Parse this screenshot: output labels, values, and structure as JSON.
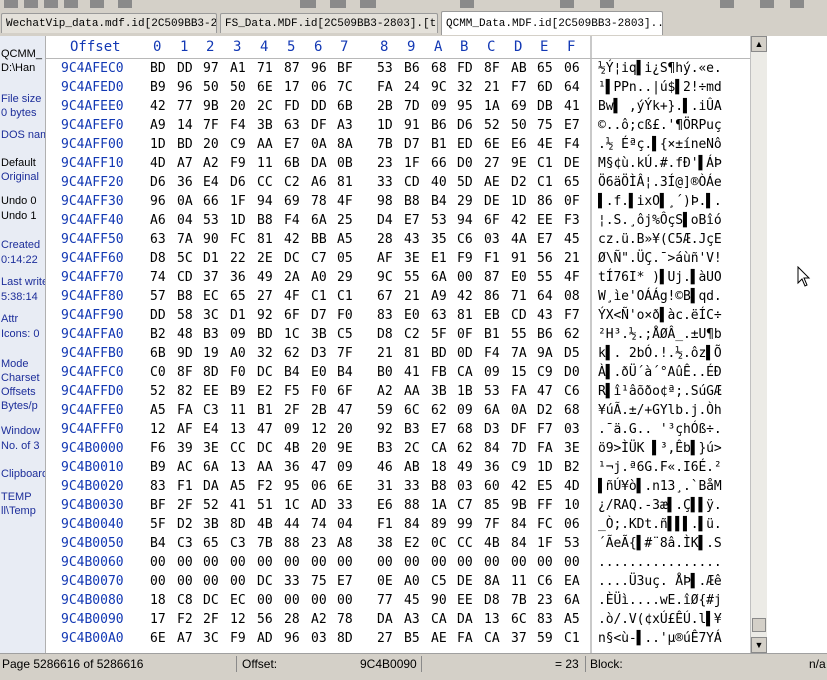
{
  "tabs": [
    {
      "label": "WechatVip_data.mdf.id[2C509BB3-2..."
    },
    {
      "label": "FS_Data.MDF.id[2C509BB3-2803].[t..."
    },
    {
      "label": "QCMM_Data.MDF.id[2C509BB3-2803]...."
    }
  ],
  "sidebar": {
    "items": [
      {
        "text": "QCMM_"
      },
      {
        "text": "D:\\Han"
      },
      {
        "text": "File size"
      },
      {
        "text": "0 bytes"
      },
      {
        "text": "DOS name"
      },
      {
        "text": "Default"
      },
      {
        "text": "Original"
      },
      {
        "text": "Undo 0"
      },
      {
        "text": "Undo 1"
      },
      {
        "text": "Created"
      },
      {
        "text": "0:14:22"
      },
      {
        "text": "Last write"
      },
      {
        "text": "5:38:14"
      },
      {
        "text": "Attr"
      },
      {
        "text": "Icons: 0"
      },
      {
        "text": "Mode"
      },
      {
        "text": "Charset"
      },
      {
        "text": "Offsets"
      },
      {
        "text": "Bytes/p"
      },
      {
        "text": "Window"
      },
      {
        "text": "No. of 3"
      },
      {
        "text": "Clipboard"
      },
      {
        "text": "TEMP"
      },
      {
        "text": "ll\\Temp"
      }
    ]
  },
  "header": {
    "offset_label": "Offset",
    "columns": [
      "0",
      "1",
      "2",
      "3",
      "4",
      "5",
      "6",
      "7",
      "8",
      "9",
      "A",
      "B",
      "C",
      "D",
      "E",
      "F"
    ]
  },
  "rows": [
    {
      "offset": "9C4AFEC0",
      "bytes": [
        "BD",
        "DD",
        "97",
        "A1",
        "71",
        "87",
        "96",
        "BF",
        "53",
        "B6",
        "68",
        "FD",
        "8F",
        "AB",
        "65",
        "06"
      ],
      "ascii": "½Ý¦iq▌i¿S¶hý.«e."
    },
    {
      "offset": "9C4AFED0",
      "bytes": [
        "B9",
        "96",
        "50",
        "50",
        "6E",
        "17",
        "06",
        "7C",
        "FA",
        "24",
        "9C",
        "32",
        "21",
        "F7",
        "6D",
        "64"
      ],
      "ascii": "¹▌PPn..|ú$▌2!÷md"
    },
    {
      "offset": "9C4AFEE0",
      "bytes": [
        "42",
        "77",
        "9B",
        "20",
        "2C",
        "FD",
        "DD",
        "6B",
        "2B",
        "7D",
        "09",
        "95",
        "1A",
        "69",
        "DB",
        "41"
      ],
      "ascii": "Bw▌ ,ýÝk+}.▌.iÛA"
    },
    {
      "offset": "9C4AFEF0",
      "bytes": [
        "A9",
        "14",
        "7F",
        "F4",
        "3B",
        "63",
        "DF",
        "A3",
        "1D",
        "91",
        "B6",
        "D6",
        "52",
        "50",
        "75",
        "E7"
      ],
      "ascii": "©..ô;cß£.'¶ÖRPuç"
    },
    {
      "offset": "9C4AFF00",
      "bytes": [
        "1D",
        "BD",
        "20",
        "C9",
        "AA",
        "E7",
        "0A",
        "8A",
        "7B",
        "D7",
        "B1",
        "ED",
        "6E",
        "E6",
        "4E",
        "F4"
      ],
      "ascii": ".½ Éªç.▌{×±íneNô"
    },
    {
      "offset": "9C4AFF10",
      "bytes": [
        "4D",
        "A7",
        "A2",
        "F9",
        "11",
        "6B",
        "DA",
        "0B",
        "23",
        "1F",
        "66",
        "D0",
        "27",
        "9E",
        "C1",
        "DE"
      ],
      "ascii": "M§¢ù.kÚ.#.fÐ'▌ÁÞ"
    },
    {
      "offset": "9C4AFF20",
      "bytes": [
        "D6",
        "36",
        "E4",
        "D6",
        "CC",
        "C2",
        "A6",
        "81",
        "33",
        "CD",
        "40",
        "5D",
        "AE",
        "D2",
        "C1",
        "65"
      ],
      "ascii": "Ö6äÖÌÂ¦.3Í@]®ÒÁe"
    },
    {
      "offset": "9C4AFF30",
      "bytes": [
        "96",
        "0A",
        "66",
        "1F",
        "94",
        "69",
        "78",
        "4F",
        "98",
        "B8",
        "B4",
        "29",
        "DE",
        "1D",
        "86",
        "0F"
      ],
      "ascii": "▌.f.▌ixO▌¸´)Þ.▌."
    },
    {
      "offset": "9C4AFF40",
      "bytes": [
        "A6",
        "04",
        "53",
        "1D",
        "B8",
        "F4",
        "6A",
        "25",
        "D4",
        "E7",
        "53",
        "94",
        "6F",
        "42",
        "EE",
        "F3"
      ],
      "ascii": "¦.S.¸ôj%ÔçS▌oBîó"
    },
    {
      "offset": "9C4AFF50",
      "bytes": [
        "63",
        "7A",
        "90",
        "FC",
        "81",
        "42",
        "BB",
        "A5",
        "28",
        "43",
        "35",
        "C6",
        "03",
        "4A",
        "E7",
        "45"
      ],
      "ascii": "cz.ü.B»¥(C5Æ.JçE"
    },
    {
      "offset": "9C4AFF60",
      "bytes": [
        "D8",
        "5C",
        "D1",
        "22",
        "2E",
        "DC",
        "C7",
        "05",
        "AF",
        "3E",
        "E1",
        "F9",
        "F1",
        "91",
        "56",
        "21"
      ],
      "ascii": "Ø\\Ñ\".ÜÇ.¯>áùñ'V!"
    },
    {
      "offset": "9C4AFF70",
      "bytes": [
        "74",
        "CD",
        "37",
        "36",
        "49",
        "2A",
        "A0",
        "29",
        "9C",
        "55",
        "6A",
        "00",
        "87",
        "E0",
        "55",
        "4F"
      ],
      "ascii": "tÍ76I* )▌Uj.▌àUO"
    },
    {
      "offset": "9C4AFF80",
      "bytes": [
        "57",
        "B8",
        "EC",
        "65",
        "27",
        "4F",
        "C1",
        "C1",
        "67",
        "21",
        "A9",
        "42",
        "86",
        "71",
        "64",
        "08"
      ],
      "ascii": "W¸ìe'OÁÁg!©B▌qd."
    },
    {
      "offset": "9C4AFF90",
      "bytes": [
        "DD",
        "58",
        "3C",
        "D1",
        "92",
        "6F",
        "D7",
        "F0",
        "83",
        "E0",
        "63",
        "81",
        "EB",
        "CD",
        "43",
        "F7"
      ],
      "ascii": "ÝX<Ñ'o×ð▌àc.ëÍC÷"
    },
    {
      "offset": "9C4AFFA0",
      "bytes": [
        "B2",
        "48",
        "B3",
        "09",
        "BD",
        "1C",
        "3B",
        "C5",
        "D8",
        "C2",
        "5F",
        "0F",
        "B1",
        "55",
        "B6",
        "62"
      ],
      "ascii": "²H³.½.;ÅØÂ_.±U¶b"
    },
    {
      "offset": "9C4AFFB0",
      "bytes": [
        "6B",
        "9D",
        "19",
        "A0",
        "32",
        "62",
        "D3",
        "7F",
        "21",
        "81",
        "BD",
        "0D",
        "F4",
        "7A",
        "9A",
        "D5"
      ],
      "ascii": "k▌. 2bÓ.!.½.ôz▌Õ"
    },
    {
      "offset": "9C4AFFC0",
      "bytes": [
        "C0",
        "8F",
        "8D",
        "F0",
        "DC",
        "B4",
        "E0",
        "B4",
        "B0",
        "41",
        "FB",
        "CA",
        "09",
        "15",
        "C9",
        "D0"
      ],
      "ascii": "À▌.ðÜ´à´°AûÊ..ÉÐ"
    },
    {
      "offset": "9C4AFFD0",
      "bytes": [
        "52",
        "82",
        "EE",
        "B9",
        "E2",
        "F5",
        "F0",
        "6F",
        "A2",
        "AA",
        "3B",
        "1B",
        "53",
        "FA",
        "47",
        "C6"
      ],
      "ascii": "R▌î¹âõðo¢ª;.SúGÆ"
    },
    {
      "offset": "9C4AFFE0",
      "bytes": [
        "A5",
        "FA",
        "C3",
        "11",
        "B1",
        "2F",
        "2B",
        "47",
        "59",
        "6C",
        "62",
        "09",
        "6A",
        "0A",
        "D2",
        "68"
      ],
      "ascii": "¥úÃ.±/+GYlb.j.Òh"
    },
    {
      "offset": "9C4AFFF0",
      "bytes": [
        "12",
        "AF",
        "E4",
        "13",
        "47",
        "09",
        "12",
        "20",
        "92",
        "B3",
        "E7",
        "68",
        "D3",
        "DF",
        "F7",
        "03"
      ],
      "ascii": ".¯ä.G.. '³çhÓß÷."
    },
    {
      "offset": "9C4B0000",
      "bytes": [
        "F6",
        "39",
        "3E",
        "CC",
        "DC",
        "4B",
        "20",
        "9E",
        "B3",
        "2C",
        "CA",
        "62",
        "84",
        "7D",
        "FA",
        "3E"
      ],
      "ascii": "ö9>ÌÜK ▌³,Êb▌}ú>"
    },
    {
      "offset": "9C4B0010",
      "bytes": [
        "B9",
        "AC",
        "6A",
        "13",
        "AA",
        "36",
        "47",
        "09",
        "46",
        "AB",
        "18",
        "49",
        "36",
        "C9",
        "1D",
        "B2"
      ],
      "ascii": "¹¬j.ª6G.F«.I6É.²"
    },
    {
      "offset": "9C4B0020",
      "bytes": [
        "83",
        "F1",
        "DA",
        "A5",
        "F2",
        "95",
        "06",
        "6E",
        "31",
        "33",
        "B8",
        "03",
        "60",
        "42",
        "E5",
        "4D"
      ],
      "ascii": "▌ñÚ¥ò▌.n13¸.`BåM"
    },
    {
      "offset": "9C4B0030",
      "bytes": [
        "BF",
        "2F",
        "52",
        "41",
        "51",
        "1C",
        "AD",
        "33",
        "E6",
        "88",
        "1A",
        "C7",
        "85",
        "9B",
        "FF",
        "10"
      ],
      "ascii": "¿/RAQ.-3æ▌.Ç▌▌ÿ."
    },
    {
      "offset": "9C4B0040",
      "bytes": [
        "5F",
        "D2",
        "3B",
        "8D",
        "4B",
        "44",
        "74",
        "04",
        "F1",
        "84",
        "89",
        "99",
        "7F",
        "84",
        "FC",
        "06"
      ],
      "ascii": "_Ò;.KDt.ñ▌▌▌.▌ü."
    },
    {
      "offset": "9C4B0050",
      "bytes": [
        "B4",
        "C3",
        "65",
        "C3",
        "7B",
        "88",
        "23",
        "A8",
        "38",
        "E2",
        "0C",
        "CC",
        "4B",
        "84",
        "1F",
        "53"
      ],
      "ascii": "´ÃeÃ{▌#¨8â.ÌK▌.S"
    },
    {
      "offset": "9C4B0060",
      "bytes": [
        "00",
        "00",
        "00",
        "00",
        "00",
        "00",
        "00",
        "00",
        "00",
        "00",
        "00",
        "00",
        "00",
        "00",
        "00",
        "00"
      ],
      "ascii": "................"
    },
    {
      "offset": "9C4B0070",
      "bytes": [
        "00",
        "00",
        "00",
        "00",
        "DC",
        "33",
        "75",
        "E7",
        "0E",
        "A0",
        "C5",
        "DE",
        "8A",
        "11",
        "C6",
        "EA"
      ],
      "ascii": "....Ü3uç. ÅÞ▌.Æê"
    },
    {
      "offset": "9C4B0080",
      "bytes": [
        "18",
        "C8",
        "DC",
        "EC",
        "00",
        "00",
        "00",
        "00",
        "77",
        "45",
        "90",
        "EE",
        "D8",
        "7B",
        "23",
        "6A"
      ],
      "ascii": ".ÈÜì....wE.îØ{#j"
    },
    {
      "offset": "9C4B0090",
      "bytes": [
        "17",
        "F2",
        "2F",
        "12",
        "56",
        "28",
        "A2",
        "78",
        "DA",
        "A3",
        "CA",
        "DA",
        "13",
        "6C",
        "83",
        "A5"
      ],
      "ascii": ".ò/.V(¢xÚ£ÊÚ.l▌¥"
    },
    {
      "offset": "9C4B00A0",
      "bytes": [
        "6E",
        "A7",
        "3C",
        "F9",
        "AD",
        "96",
        "03",
        "8D",
        "27",
        "B5",
        "AE",
        "FA",
        "CA",
        "37",
        "59",
        "C1"
      ],
      "ascii": "n§<ù-▌..'µ®úÊ7YÁ"
    }
  ],
  "status": {
    "page": "Page 5286616 of 5286616",
    "offset_label": "Offset:",
    "offset_value": "9C4B0090",
    "value": "= 23",
    "block_label": "Block:",
    "na": "n/a"
  }
}
